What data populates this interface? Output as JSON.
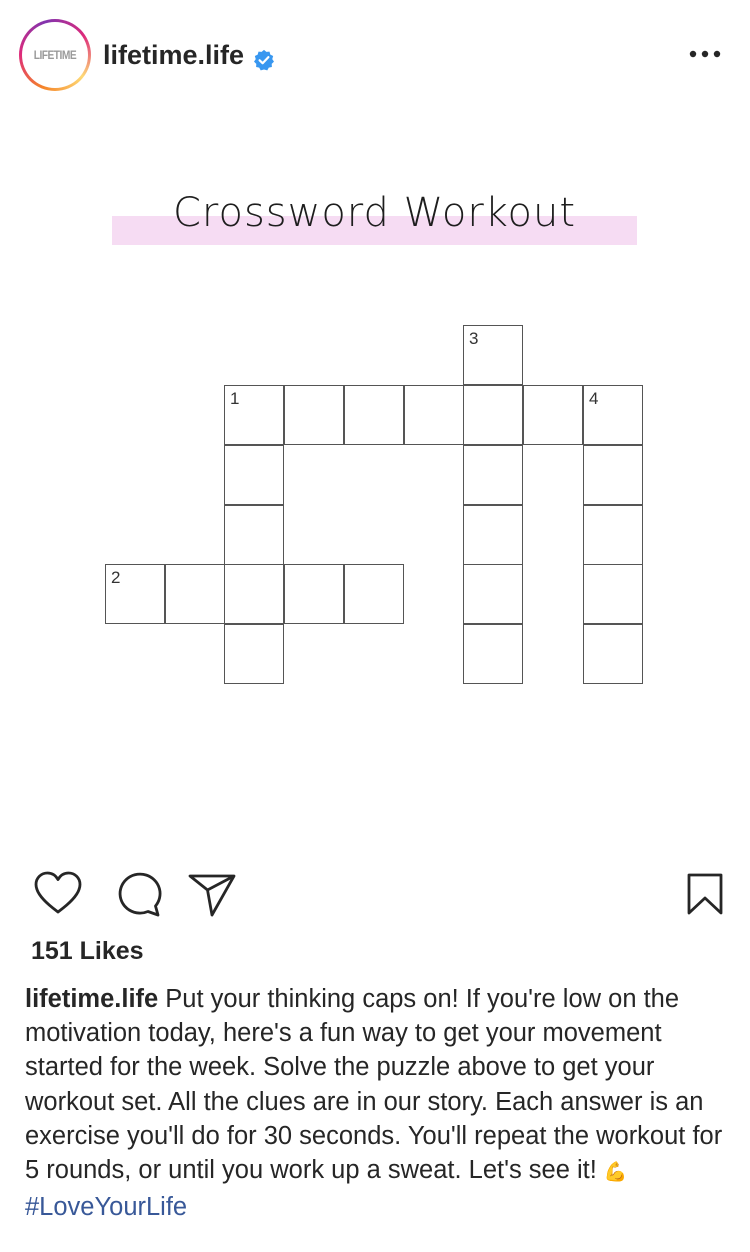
{
  "header": {
    "avatar_text": "LIFETIME",
    "username": "lifetime.life"
  },
  "post": {
    "image": {
      "title": "Crossword Workout",
      "clue_numbers": [
        "1",
        "2",
        "3",
        "4"
      ]
    },
    "likes": "151 Likes",
    "caption": {
      "username": "lifetime.life",
      "text": " Put your thinking caps on! If you're low on the motivation today, here's a fun way to get your movement started for the week. Solve the puzzle above to get your workout set. All the clues are in our story. Each answer is an exercise you'll do for 30 seconds. You'll repeat the workout for 5 rounds, or until you work up a sweat. Let's see it! ",
      "emoji": "💪",
      "hashtag": "#LoveYourLife"
    }
  },
  "icons": {
    "verified": "verified-badge-icon",
    "more": "more-options-icon",
    "like": "heart-icon",
    "comment": "comment-icon",
    "share": "send-icon",
    "save": "bookmark-icon"
  },
  "colors": {
    "text": "#262626",
    "hashtag": "#385898",
    "verified": "#3897f0",
    "title_highlight": "#f6dcf3",
    "grid_line": "#555555"
  }
}
